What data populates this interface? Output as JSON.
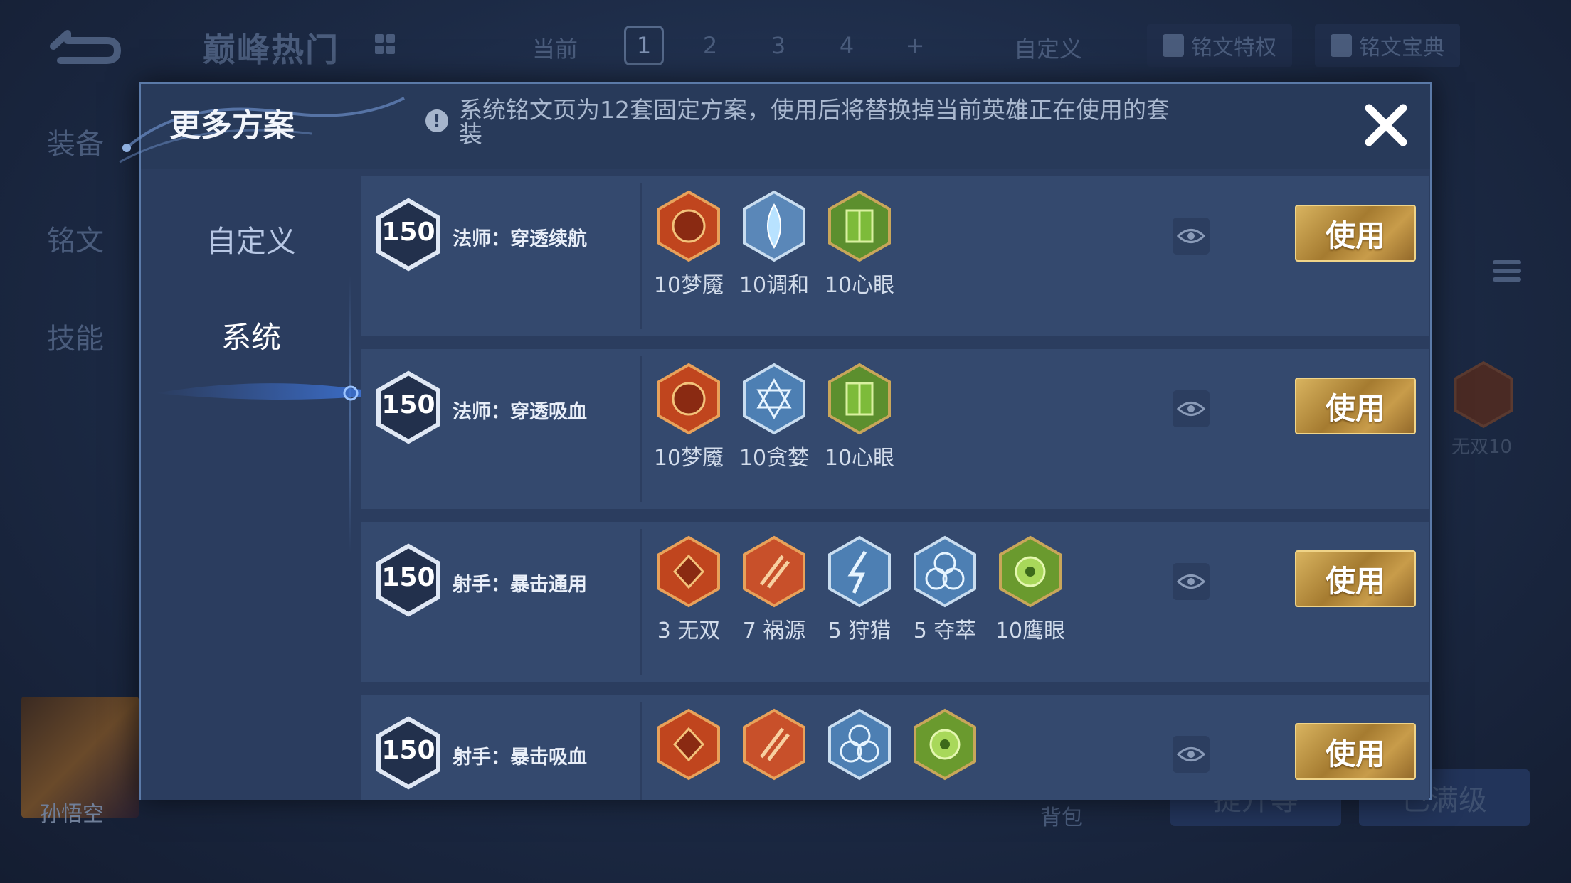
{
  "background": {
    "title": "巅峰热门",
    "current_label": "当前",
    "pages": [
      "1",
      "2",
      "3",
      "4",
      "+"
    ],
    "custom_label": "自定义",
    "privilege_label": "铭文特权",
    "handbook_label": "铭文宝典",
    "left_nav": [
      "装备",
      "铭文",
      "技能"
    ],
    "side_rune_label": "无双10",
    "hero_name": "孙悟空",
    "bag_label": "背包",
    "upgrade_label": "提升等",
    "full_level_label": "已满级"
  },
  "modal": {
    "title": "更多方案",
    "info_text": "系统铭文页为12套固定方案，使用后将替换掉当前英雄正在使用的套装",
    "side_menu": [
      "自定义",
      "系统"
    ],
    "active_menu": "系统"
  },
  "plans": [
    {
      "level": "150",
      "name": "法师：穿透续航",
      "runes": [
        {
          "label": "10梦魇",
          "color": "#c0451e",
          "icon": "red-rune-icon"
        },
        {
          "label": "10调和",
          "color": "#5a87b8",
          "icon": "blue-rune-icon"
        },
        {
          "label": "10心眼",
          "color": "#5c8f2e",
          "icon": "green-rune-icon"
        }
      ],
      "button": "使用"
    },
    {
      "level": "150",
      "name": "法师：穿透吸血",
      "runes": [
        {
          "label": "10梦魇",
          "color": "#c0451e",
          "icon": "red-rune-icon"
        },
        {
          "label": "10贪婪",
          "color": "#4d7fb3",
          "icon": "blue-rune-icon"
        },
        {
          "label": "10心眼",
          "color": "#5c8f2e",
          "icon": "green-rune-icon"
        }
      ],
      "button": "使用"
    },
    {
      "level": "150",
      "name": "射手：暴击通用",
      "runes": [
        {
          "label": "3 无双",
          "color": "#c0451e",
          "icon": "red-rune-icon"
        },
        {
          "label": "7 祸源",
          "color": "#c0451e",
          "icon": "red-rune-icon"
        },
        {
          "label": "5 狩猎",
          "color": "#4d7fb3",
          "icon": "blue-rune-icon"
        },
        {
          "label": "5 夺萃",
          "color": "#4d7fb3",
          "icon": "blue-rune-icon"
        },
        {
          "label": "10鹰眼",
          "color": "#6a9a2e",
          "icon": "green-rune-icon"
        }
      ],
      "button": "使用"
    },
    {
      "level": "150",
      "name": "射手：暴击吸血",
      "runes": [
        {
          "label": "",
          "color": "#c0451e",
          "icon": "red-rune-icon"
        },
        {
          "label": "",
          "color": "#c0451e",
          "icon": "red-rune-icon"
        },
        {
          "label": "",
          "color": "#4d7fb3",
          "icon": "blue-rune-icon"
        },
        {
          "label": "",
          "color": "#6a9a2e",
          "icon": "green-rune-icon"
        }
      ],
      "button": "使用"
    }
  ]
}
